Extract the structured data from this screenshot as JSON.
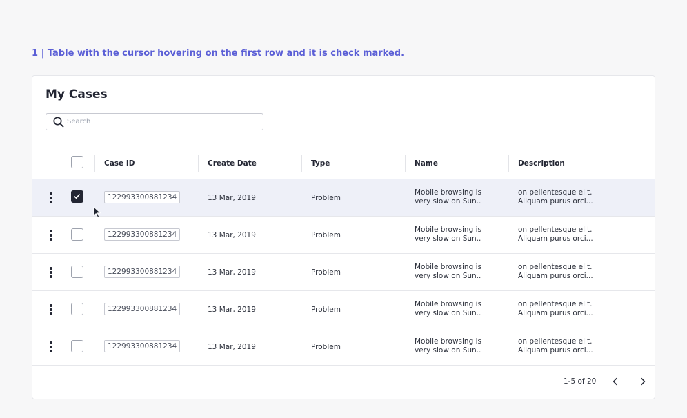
{
  "caption": "1 | Table with the cursor hovering on the first row and it is check marked.",
  "card": {
    "title": "My Cases",
    "search": {
      "placeholder": "Search",
      "value": ""
    }
  },
  "table": {
    "columns": [
      "Case ID",
      "Create Date",
      "Type",
      "Name",
      "Description"
    ],
    "rows": [
      {
        "selected": true,
        "case_id": "122993300881234",
        "create_date": "13 Mar, 2019",
        "type": "Problem",
        "name_line1": "Mobile browsing is",
        "name_line2": "very slow on Sun..",
        "desc_line1": "on pellentesque elit.",
        "desc_line2": "Aliquam purus orci..."
      },
      {
        "selected": false,
        "case_id": "122993300881234",
        "create_date": "13 Mar, 2019",
        "type": "Problem",
        "name_line1": "Mobile browsing is",
        "name_line2": "very slow on Sun..",
        "desc_line1": "on pellentesque elit.",
        "desc_line2": "Aliquam purus orci..."
      },
      {
        "selected": false,
        "case_id": "122993300881234",
        "create_date": "13 Mar, 2019",
        "type": "Problem",
        "name_line1": "Mobile browsing is",
        "name_line2": "very slow on Sun..",
        "desc_line1": "on pellentesque elit.",
        "desc_line2": "Aliquam purus orci..."
      },
      {
        "selected": false,
        "case_id": "122993300881234",
        "create_date": "13 Mar, 2019",
        "type": "Problem",
        "name_line1": "Mobile browsing is",
        "name_line2": "very slow on Sun..",
        "desc_line1": "on pellentesque elit.",
        "desc_line2": "Aliquam purus orci..."
      },
      {
        "selected": false,
        "case_id": "122993300881234",
        "create_date": "13 Mar, 2019",
        "type": "Problem",
        "name_line1": "Mobile browsing is",
        "name_line2": "very slow on Sun..",
        "desc_line1": "on pellentesque elit.",
        "desc_line2": "Aliquam purus orci..."
      }
    ]
  },
  "pagination": {
    "range_text": "1-5 of 20"
  },
  "icons": {
    "search": "search-icon",
    "row_menu": "kebab-menu-icon",
    "check": "checkmark-icon",
    "prev": "chevron-left-icon",
    "next": "chevron-right-icon",
    "cursor": "mouse-pointer-icon"
  },
  "colors": {
    "caption": "#5b5fd6",
    "selected_row_bg": "#eef0f8",
    "checkbox_checked": "#232633"
  }
}
